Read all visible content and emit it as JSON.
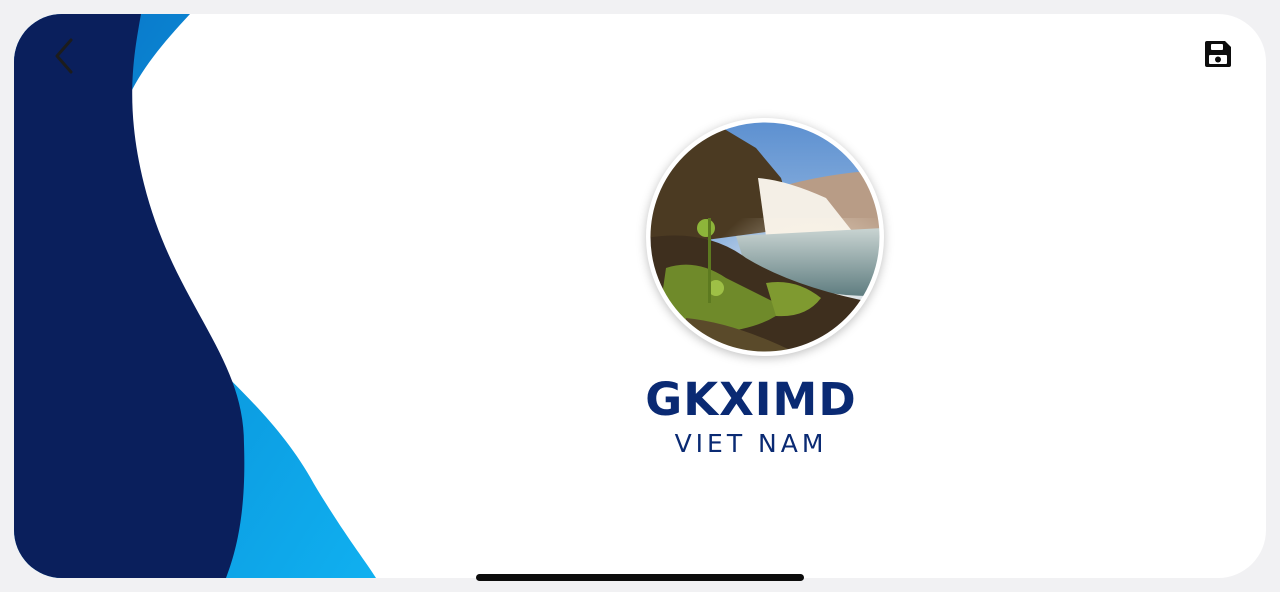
{
  "brand": {
    "name": "GKXIMD",
    "subtitle": "VIET NAM"
  },
  "colors": {
    "navy": "#0a1f5c",
    "blue": "#0a8fd8",
    "light_blue": "#16a8ee",
    "brand_text": "#0a2a73"
  },
  "icons": {
    "back": "chevron-left-icon",
    "save": "floppy-disk-icon"
  }
}
